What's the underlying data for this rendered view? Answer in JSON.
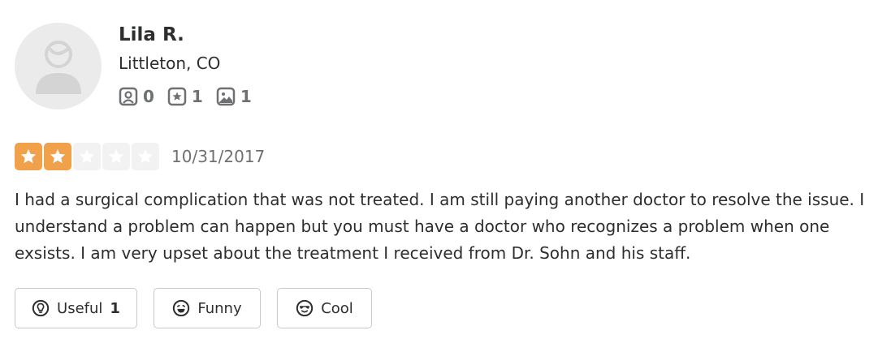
{
  "user": {
    "name": "Lila R.",
    "location": "Littleton, CO",
    "stats": {
      "friends": "0",
      "reviews": "1",
      "photos": "1"
    }
  },
  "review": {
    "rating": 2,
    "max_rating": 5,
    "date": "10/31/2017",
    "text": "I had a surgical complication that was not treated. I am still paying another doctor to resolve the issue. I understand a problem can happen but you must have a doctor who recognizes a problem when one exsists. I am very upset about the treatment I received from Dr. Sohn and his staff."
  },
  "reactions": {
    "useful_label": "Useful",
    "useful_count": "1",
    "funny_label": "Funny",
    "cool_label": "Cool"
  },
  "colors": {
    "star_active": "#f0a149",
    "star_inactive": "#f2f2f2"
  }
}
